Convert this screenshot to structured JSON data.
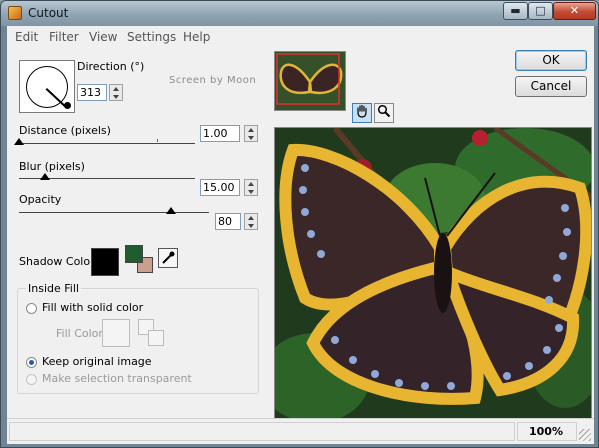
{
  "window": {
    "title": "Cutout",
    "min_glyph": "▬",
    "max_glyph": "□",
    "close_glyph": "✕"
  },
  "menu": [
    "Edit",
    "Filter",
    "View",
    "Settings",
    "Help"
  ],
  "direction": {
    "label": "Direction (°)",
    "value": "313",
    "angle_deg": 313
  },
  "watermark": "Screen by Moon",
  "distance": {
    "label": "Distance (pixels)",
    "value": "1.00",
    "level": 0.0
  },
  "blur": {
    "label": "Blur (pixels)",
    "value": "15.00",
    "level": 0.15
  },
  "opacity": {
    "label": "Opacity",
    "value": "80",
    "level": 0.8
  },
  "shadow_color": {
    "label": "Shadow Color",
    "primary": "#000000",
    "secondary": "#1f5c2e",
    "tertiary": "#c9a08e"
  },
  "inside_fill": {
    "title": "Inside Fill",
    "option_solid": "Fill with solid color",
    "fill_color_label": "Fill Color",
    "option_keep": "Keep original image",
    "option_transparent": "Make selection transparent"
  },
  "buttons": {
    "ok": "OK",
    "cancel": "Cancel"
  },
  "tools": {
    "hand": "pan-hand-icon",
    "zoom": "magnifier-icon"
  },
  "status": {
    "zoom": "100%"
  },
  "colors": {
    "accent": "#3c7fb1",
    "titlebar": "#8fa4b3"
  }
}
